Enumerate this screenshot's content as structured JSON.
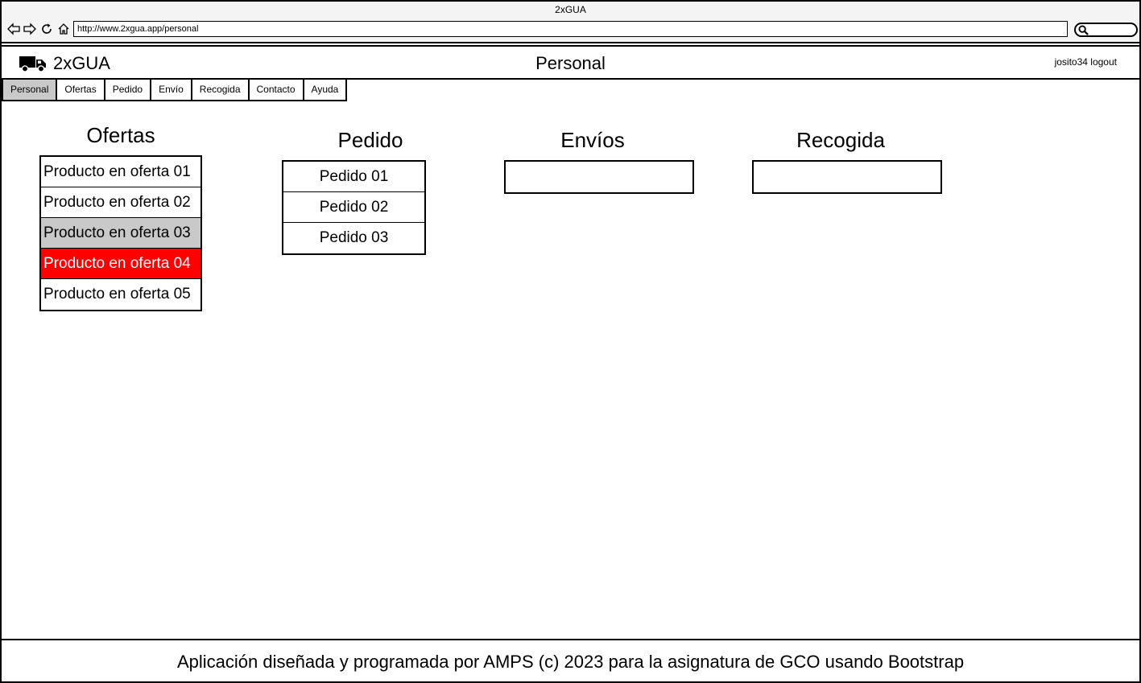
{
  "browser": {
    "window_title": "2xGUA",
    "url": "http://www.2xgua.app/personal",
    "search_placeholder": ""
  },
  "header": {
    "brand": "2xGUA",
    "title": "Personal",
    "user": "josito34",
    "logout": "logout"
  },
  "tabs": [
    "Personal",
    "Ofertas",
    "Pedido",
    "Envío",
    "Recogida",
    "Contacto",
    "Ayuda"
  ],
  "active_tab": "Personal",
  "sections": {
    "ofertas": {
      "title": "Ofertas",
      "items": [
        "Producto en oferta 01",
        "Producto en oferta 02",
        "Producto en oferta 03",
        "Producto en oferta 04",
        "Producto en oferta 05"
      ]
    },
    "pedido": {
      "title": "Pedido",
      "items": [
        "Pedido 01",
        "Pedido 02",
        "Pedido 03"
      ]
    },
    "envios": {
      "title": "Envíos"
    },
    "recogida": {
      "title": "Recogida"
    }
  },
  "colors": {
    "highlight_grey": "#c9c9c9",
    "highlight_red": "#ff0000"
  },
  "footer": {
    "text": "Aplicación diseñada y programada por AMPS (c) 2023 para la asignatura de GCO usando Bootstrap"
  }
}
